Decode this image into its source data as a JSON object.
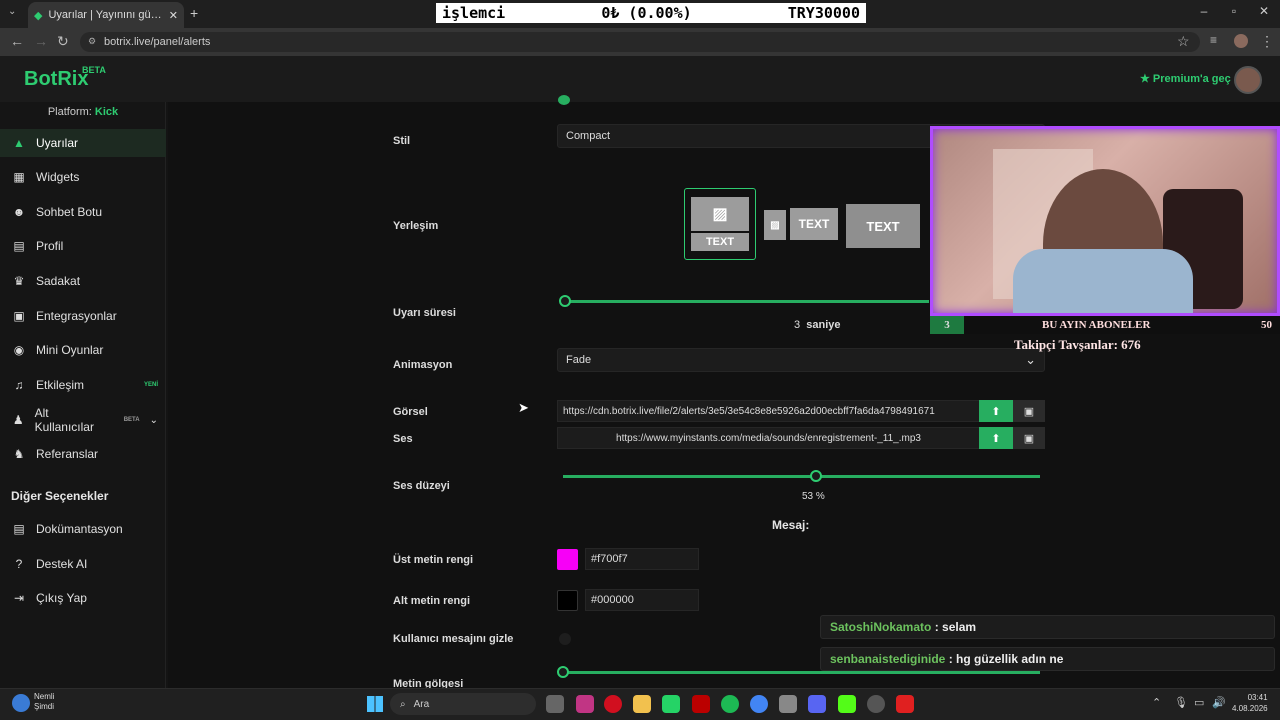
{
  "browser": {
    "tab_title": "Uyarılar | Yayınını güçlendirmek",
    "url": "botrix.live/panel/alerts",
    "ticker": {
      "left": "işlemci",
      "middle": "0₺ (0.00%)",
      "right": "TRY30000"
    }
  },
  "header": {
    "logo": "BotRix",
    "logo_badge": "BETA",
    "premium": "Premium'a geç"
  },
  "sidebar": {
    "platform_label": "Platform:",
    "platform_value": "Kick",
    "items": [
      {
        "label": "Uyarılar",
        "icon": "warning-icon"
      },
      {
        "label": "Widgets",
        "icon": "widgets-icon"
      },
      {
        "label": "Sohbet Botu",
        "icon": "robot-icon"
      },
      {
        "label": "Profil",
        "icon": "profile-card-icon"
      },
      {
        "label": "Sadakat",
        "icon": "trophy-icon"
      },
      {
        "label": "Entegrasyonlar",
        "icon": "integration-icon"
      },
      {
        "label": "Mini Oyunlar",
        "icon": "gamepad-icon"
      },
      {
        "label": "Etkileşim",
        "icon": "music-icon",
        "tag": "YENİ"
      },
      {
        "label": "Alt Kullanıcılar",
        "icon": "users-icon",
        "tag": "BETA"
      },
      {
        "label": "Referanslar",
        "icon": "referral-icon"
      }
    ],
    "other_heading": "Diğer Seçenekler",
    "other_items": [
      {
        "label": "Dokümantasyon",
        "icon": "docs-icon"
      },
      {
        "label": "Destek AI",
        "icon": "help-icon"
      },
      {
        "label": "Çıkış Yap",
        "icon": "logout-icon"
      }
    ]
  },
  "form": {
    "stil_label": "Stil",
    "stil_value": "Compact",
    "yerlesim_label": "Yerleşim",
    "layout_text": "TEXT",
    "sure_label": "Uyarı süresi",
    "sure_value": "3",
    "sure_unit": "saniye",
    "sure_fraction": 0.0,
    "animasyon_label": "Animasyon",
    "animasyon_value": "Fade",
    "gorsel_label": "Görsel",
    "gorsel_url": "https://cdn.botrix.live/file/2/alerts/3e5/3e54c8e8e5926a2d00ecbff7fa6da4798491671",
    "ses_label": "Ses",
    "ses_url": "https://www.myinstants.com/media/sounds/enregistrement-_11_.mp3",
    "ses_duzeyi_label": "Ses düzeyi",
    "ses_duzeyi_value": "53 %",
    "ses_duzeyi_fraction": 0.53,
    "mesaj_heading": "Mesaj:",
    "ust_renk_label": "Üst metin rengi",
    "ust_renk_value": "#f700f7",
    "alt_renk_label": "Alt metin rengi",
    "alt_renk_value": "#000000",
    "gizle_label": "Kullanıcı mesajını gizle",
    "golge_label": "Metin gölgesi"
  },
  "overlay": {
    "sub_count": "3",
    "sub_title": "BU AYIN ABONELER",
    "sub_goal": "50",
    "followers": "Takipçi Tavşanlar: 676"
  },
  "chat": [
    {
      "user": "SatoshiNokamato",
      "message": "selam"
    },
    {
      "user": "senbanaistediginide",
      "message": "hg güzellik adın ne"
    }
  ],
  "taskbar": {
    "notif_title": "Nemli",
    "notif_sub": "Şimdi",
    "search": "Ara",
    "time": "03:41",
    "date": "4.08.2026"
  },
  "colors": {
    "accent": "#2ecc71",
    "magenta": "#f700f7",
    "overlay_border": "#b04cff"
  }
}
